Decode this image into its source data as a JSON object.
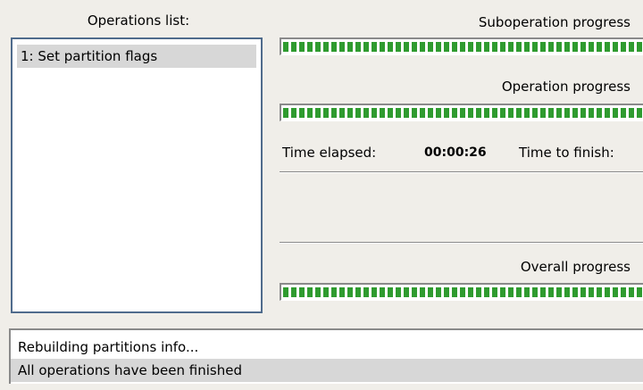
{
  "operations": {
    "header": "Operations list:",
    "items": [
      "1: Set partition flags"
    ]
  },
  "suboperation": {
    "label": "Suboperation progress",
    "progress": 1.0
  },
  "operation": {
    "label": "Operation progress",
    "progress": 1.0
  },
  "time": {
    "elapsed_label": "Time elapsed:",
    "elapsed_value": "00:00:26",
    "finish_label": "Time to finish:"
  },
  "overall": {
    "label": "Overall progress",
    "progress": 1.0
  },
  "log": {
    "lines": [
      "Rebuilding partitions info...",
      "All operations have been finished"
    ]
  },
  "colors": {
    "progress_fill": "#2f9b2f",
    "list_border": "#4f6b8c",
    "selection": "#d7d7d7"
  }
}
